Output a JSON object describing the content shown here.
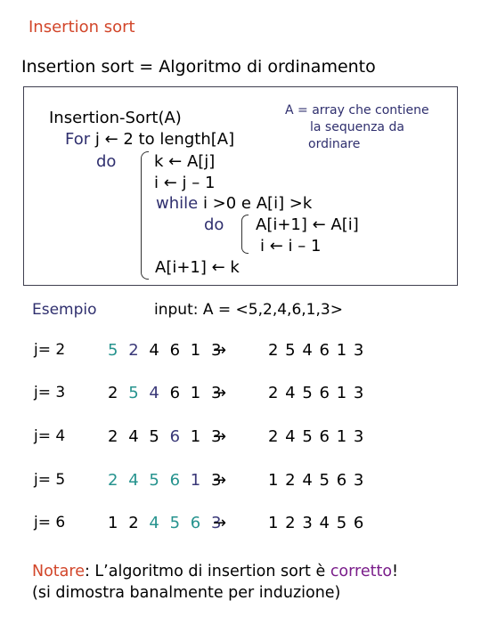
{
  "title": "Insertion sort",
  "subtitle": "Insertion sort = Algoritmo di ordinamento",
  "pseudocode": {
    "header": "Insertion-Sort(A)",
    "for_keyword": "For",
    "for_rest": "j ← 2 to length[A]",
    "do_outer": "do",
    "lines": [
      "k ← A[j]",
      "i ← j – 1"
    ],
    "while_keyword": "while",
    "while_rest": "i >0 e A[i] >k",
    "do_inner": "do",
    "inner_lines": [
      "A[i+1]  ← A[i]",
      "i  ← i – 1"
    ],
    "last_line": "A[i+1] ← k",
    "note": [
      "A = array che contiene",
      "la sequenza da",
      "ordinare"
    ]
  },
  "example": {
    "label": "Esempio",
    "input": "input:  A = <5,2,4,6,1,3>",
    "arrow": "→",
    "rows": [
      {
        "j": "j= 2",
        "before": [
          {
            "d": "5",
            "c": "teal"
          },
          {
            "d": "2",
            "c": "navy"
          },
          {
            "d": "4",
            "c": "blk"
          },
          {
            "d": "6",
            "c": "blk"
          },
          {
            "d": "1",
            "c": "blk"
          },
          {
            "d": "3",
            "c": "blk"
          }
        ],
        "after": "2 5 4 6 1 3"
      },
      {
        "j": "j= 3",
        "before": [
          {
            "d": "2",
            "c": "blk"
          },
          {
            "d": "5",
            "c": "teal"
          },
          {
            "d": "4",
            "c": "navy"
          },
          {
            "d": "6",
            "c": "blk"
          },
          {
            "d": "1",
            "c": "blk"
          },
          {
            "d": "3",
            "c": "blk"
          }
        ],
        "after": "2 4 5 6 1 3"
      },
      {
        "j": "j= 4",
        "before": [
          {
            "d": "2",
            "c": "blk"
          },
          {
            "d": "4",
            "c": "blk"
          },
          {
            "d": "5",
            "c": "blk"
          },
          {
            "d": "6",
            "c": "navy"
          },
          {
            "d": "1",
            "c": "blk"
          },
          {
            "d": "3",
            "c": "blk"
          }
        ],
        "after": "2 4 5 6 1 3"
      },
      {
        "j": "j= 5",
        "before": [
          {
            "d": "2",
            "c": "teal"
          },
          {
            "d": "4",
            "c": "teal"
          },
          {
            "d": "5",
            "c": "teal"
          },
          {
            "d": "6",
            "c": "teal"
          },
          {
            "d": "1",
            "c": "navy"
          },
          {
            "d": "3",
            "c": "blk"
          }
        ],
        "after": "1 2 4 5 6 3"
      },
      {
        "j": "j= 6",
        "before": [
          {
            "d": "1",
            "c": "blk"
          },
          {
            "d": "2",
            "c": "blk"
          },
          {
            "d": "4",
            "c": "teal"
          },
          {
            "d": "5",
            "c": "teal"
          },
          {
            "d": "6",
            "c": "teal"
          },
          {
            "d": "3",
            "c": "navy"
          }
        ],
        "after": "1 2 3 4 5 6"
      }
    ]
  },
  "footer": {
    "notare": "Notare",
    "colon_text": ":  L’algoritmo di insertion sort è ",
    "corretto": "corretto",
    "exclaim": "!",
    "line2": "(si dimostra banalmente per induzione)"
  },
  "colors": {
    "title": "#d2462a",
    "keyword": "#2f2f6e",
    "highlight_sorted": "#26938e",
    "highlight_key": "#3a3878",
    "corretto": "#7a1d8a"
  }
}
